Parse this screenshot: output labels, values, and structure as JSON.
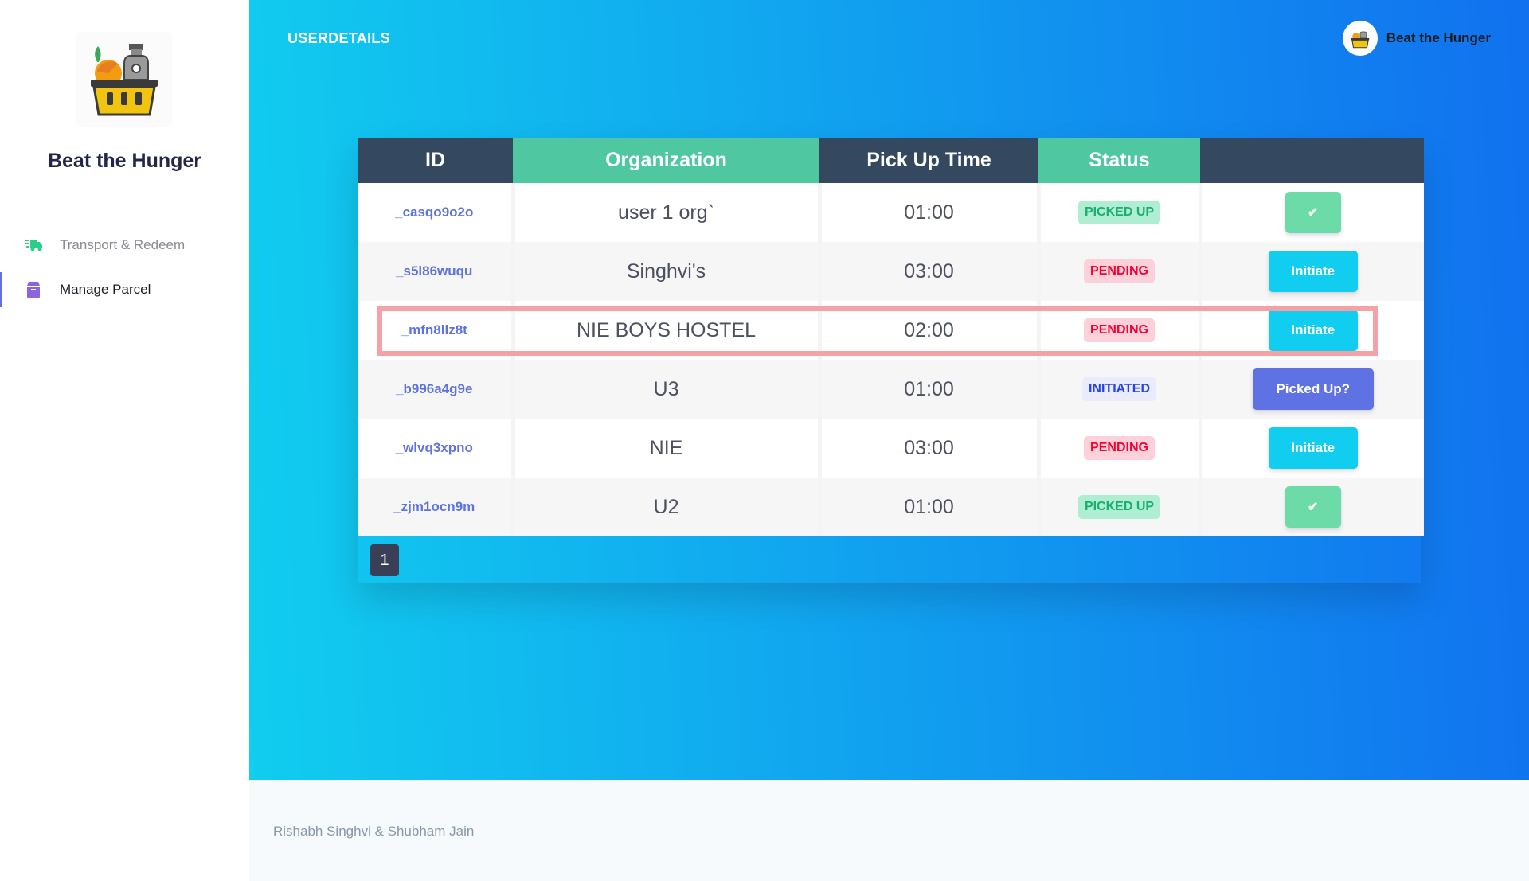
{
  "sidebar": {
    "brand": "Beat the Hunger",
    "logo_icon": "grocery-basket-icon",
    "items": [
      {
        "label": "Transport & Redeem",
        "icon": "delivery-truck-icon",
        "color": "#2dce89",
        "active": false
      },
      {
        "label": "Manage Parcel",
        "icon": "parcel-box-icon",
        "color": "#8965e0",
        "active": true
      }
    ]
  },
  "header": {
    "title": "USERDETAILS",
    "user_name": "Beat the Hunger"
  },
  "table": {
    "columns": [
      "ID",
      "Organization",
      "Pick Up Time",
      "Status",
      ""
    ],
    "rows": [
      {
        "id": "_casqo9o2o",
        "org": "user 1 org`",
        "time": "01:00",
        "status": "PICKED UP",
        "action": "✔"
      },
      {
        "id": "_s5l86wuqu",
        "org": "Singhvi's",
        "time": "03:00",
        "status": "PENDING",
        "action": "Initiate"
      },
      {
        "id": "_mfn8llz8t",
        "org": "NIE BOYS HOSTEL",
        "time": "02:00",
        "status": "PENDING",
        "action": "Initiate"
      },
      {
        "id": "_b996a4g9e",
        "org": "U3",
        "time": "01:00",
        "status": "INITIATED",
        "action": "Picked Up?"
      },
      {
        "id": "_wlvq3xpno",
        "org": "NIE",
        "time": "03:00",
        "status": "PENDING",
        "action": "Initiate"
      },
      {
        "id": "_zjm1ocn9m",
        "org": "U2",
        "time": "01:00",
        "status": "PICKED UP",
        "action": "✔"
      }
    ]
  },
  "pagination": {
    "current_page": "1"
  },
  "footer": {
    "credit": "Rishabh Singhvi & Shubham Jain"
  },
  "colors": {
    "gradient_start": "#11cdef",
    "gradient_end": "#1171ef",
    "header_dark": "#344960",
    "header_green": "#4fc7a0",
    "highlight_border": "#f4a2a8"
  }
}
